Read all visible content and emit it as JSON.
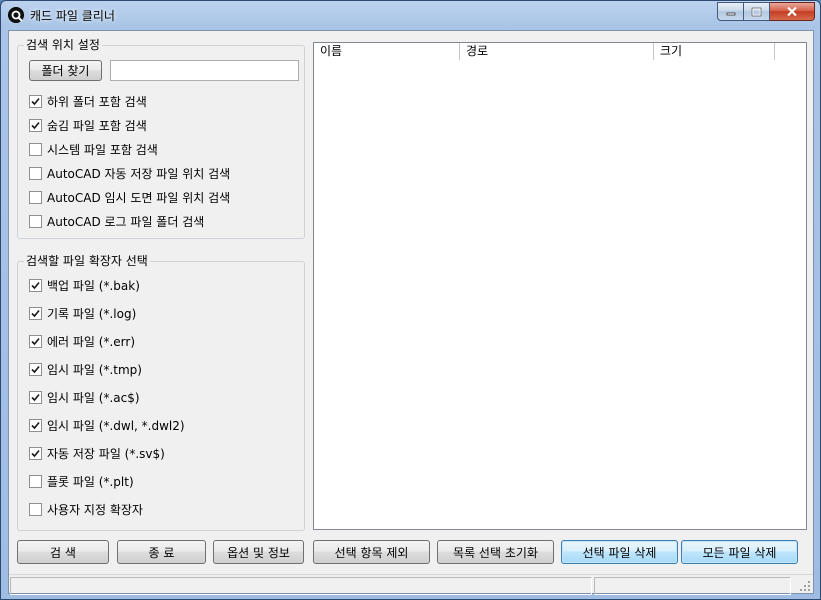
{
  "window": {
    "title": "캐드 파일 클리너",
    "icon": "magnifier-icon"
  },
  "search_location": {
    "title": "검색 위치 설정",
    "folder_button": "폴더 찾기",
    "folder_path": "",
    "options": [
      {
        "label": "하위 폴더 포함 검색",
        "checked": true
      },
      {
        "label": "숨김 파일 포함 검색",
        "checked": true
      },
      {
        "label": "시스템 파일 포함 검색",
        "checked": false
      },
      {
        "label": "AutoCAD 자동 저장 파일 위치 검색",
        "checked": false
      },
      {
        "label": "AutoCAD 임시 도면 파일 위치 검색",
        "checked": false
      },
      {
        "label": "AutoCAD 로그 파일 폴더 검색",
        "checked": false
      }
    ]
  },
  "extensions": {
    "title": "검색할 파일 확장자 선택",
    "items": [
      {
        "label": "백업 파일 (*.bak)",
        "checked": true
      },
      {
        "label": "기록 파일 (*.log)",
        "checked": true
      },
      {
        "label": "에러 파일 (*.err)",
        "checked": true
      },
      {
        "label": "임시 파일 (*.tmp)",
        "checked": true
      },
      {
        "label": "임시 파일 (*.ac$)",
        "checked": true
      },
      {
        "label": "임시 파일 (*.dwl, *.dwl2)",
        "checked": true
      },
      {
        "label": "자동 저장 파일 (*.sv$)",
        "checked": true
      },
      {
        "label": "플롯 파일 (*.plt)",
        "checked": false
      },
      {
        "label": "사용자 지정 확장자",
        "checked": false
      }
    ]
  },
  "file_list": {
    "columns": [
      "이름",
      "경로",
      "크기",
      ""
    ]
  },
  "buttons": {
    "search": "검 색",
    "exit": "종 료",
    "options": "옵션 및 정보",
    "exclude_selected": "선택 항목 제외",
    "reset_selection": "목록 선택 초기화",
    "delete_selected": "선택 파일 삭제",
    "delete_all": "모든 파일 삭제"
  },
  "status": {
    "left": "",
    "right": ""
  },
  "colors": {
    "title_bar": "#a9c4e6",
    "close_button": "#c33c22",
    "highlight_button": "#bee6fd"
  }
}
